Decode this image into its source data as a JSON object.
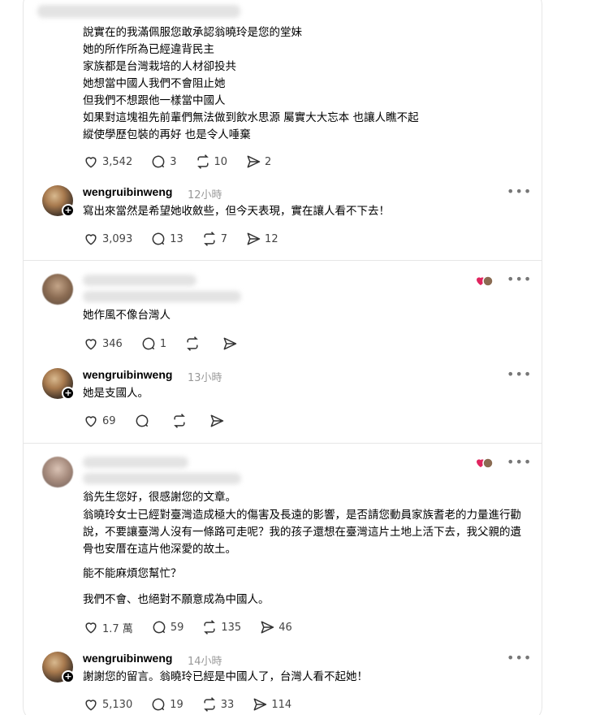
{
  "thread": {
    "comment1": {
      "lines": [
        "說實在的我滿佩服您敢承認翁曉玲是您的堂妹",
        "她的所作所為已經違背民主",
        "家族都是台灣栽培的人材卻投共",
        "她想當中國人我們不會阻止她",
        "但我們不想跟他一樣當中國人",
        "如果對這塊祖先前輩們無法做到飲水思源 屬實大大忘本 也讓人瞧不起",
        "縱使學歷包裝的再好 也是令人唾棄"
      ],
      "likes": "3,542",
      "replies": "3",
      "reposts": "10",
      "shares": "2"
    },
    "reply1": {
      "username": "wengruibinweng",
      "time": "12小時",
      "text": "寫出來當然是希望她收斂些，但今天表現，實在讓人看不下去！",
      "likes": "3,093",
      "replies": "13",
      "reposts": "7",
      "shares": "12"
    },
    "comment2": {
      "text": "她作風不像台灣人",
      "likes": "346",
      "replies": "1"
    },
    "reply2": {
      "username": "wengruibinweng",
      "time": "13小時",
      "text": "她是支國人。",
      "likes": "69"
    },
    "comment3": {
      "p1": "翁先生您好，很感謝您的文章。",
      "p2": "翁曉玲女士已經對臺灣造成極大的傷害及長遠的影響，是否請您動員家族耆老的力量進行勸說，不要讓臺灣人沒有一條路可走呢？我的孩子還想在臺灣這片土地上活下去，我父親的遺骨也安厝在這片他深愛的故土。",
      "p3": "能不能麻煩您幫忙？",
      "p4": "我們不會、也絕對不願意成為中國人。",
      "likes": "1.7 萬",
      "replies": "59",
      "reposts": "135",
      "shares": "46"
    },
    "reply3": {
      "username": "wengruibinweng",
      "time": "14小時",
      "text": "謝謝您的留言。翁曉玲已經是中國人了，台灣人看不起她！",
      "likes": "5,130",
      "replies": "19",
      "reposts": "33",
      "shares": "114"
    },
    "more_label": "•••",
    "plus_label": "+"
  },
  "icons": [
    "heart-icon",
    "comment-icon",
    "repost-icon",
    "share-icon",
    "more-icon",
    "follow-plus-icon",
    "reaction-icon"
  ]
}
